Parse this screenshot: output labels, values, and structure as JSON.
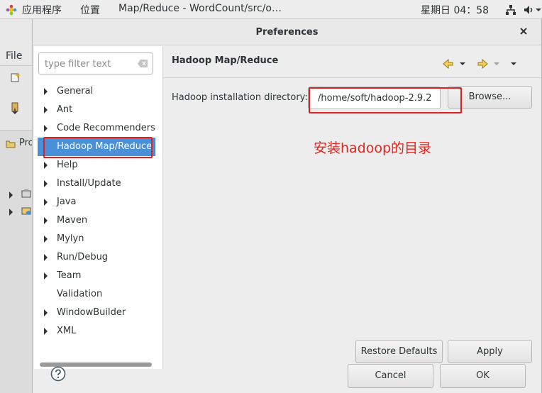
{
  "topbar": {
    "app_menu": "应用程序",
    "places": "位置",
    "window_title": "Map/Reduce - WordCount/src/o…",
    "clock": "星期日 04：58"
  },
  "background": {
    "file_menu": "File",
    "panel_tab": "Pro"
  },
  "dialog": {
    "title": "Preferences",
    "filter_placeholder": "type filter text",
    "tree": [
      {
        "label": "General",
        "expandable": true
      },
      {
        "label": "Ant",
        "expandable": true
      },
      {
        "label": "Code Recommenders",
        "expandable": true
      },
      {
        "label": "Hadoop Map/Reduce",
        "expandable": false,
        "selected": true
      },
      {
        "label": "Help",
        "expandable": true
      },
      {
        "label": "Install/Update",
        "expandable": true
      },
      {
        "label": "Java",
        "expandable": true
      },
      {
        "label": "Maven",
        "expandable": true
      },
      {
        "label": "Mylyn",
        "expandable": true
      },
      {
        "label": "Run/Debug",
        "expandable": true
      },
      {
        "label": "Team",
        "expandable": true
      },
      {
        "label": "Validation",
        "expandable": false
      },
      {
        "label": "WindowBuilder",
        "expandable": true
      },
      {
        "label": "XML",
        "expandable": true
      }
    ],
    "page_title": "Hadoop Map/Reduce",
    "install_label": "Hadoop installation directory:",
    "install_value": "/home/soft/hadoop-2.9.2",
    "browse_label": "Browse...",
    "annotation": "安装hadoop的目录",
    "restore_label": "Restore Defaults",
    "apply_label": "Apply",
    "cancel_label": "Cancel",
    "ok_label": "OK"
  },
  "colors": {
    "selection": "#4a90d9",
    "annotation_red": "#e8231b"
  },
  "icons": [
    "app-menu-icon",
    "network-icon",
    "volume-icon",
    "chevron-down-icon",
    "close-icon",
    "clear-text-icon",
    "back-arrow-icon",
    "forward-arrow-icon",
    "view-menu-icon",
    "help-icon"
  ]
}
